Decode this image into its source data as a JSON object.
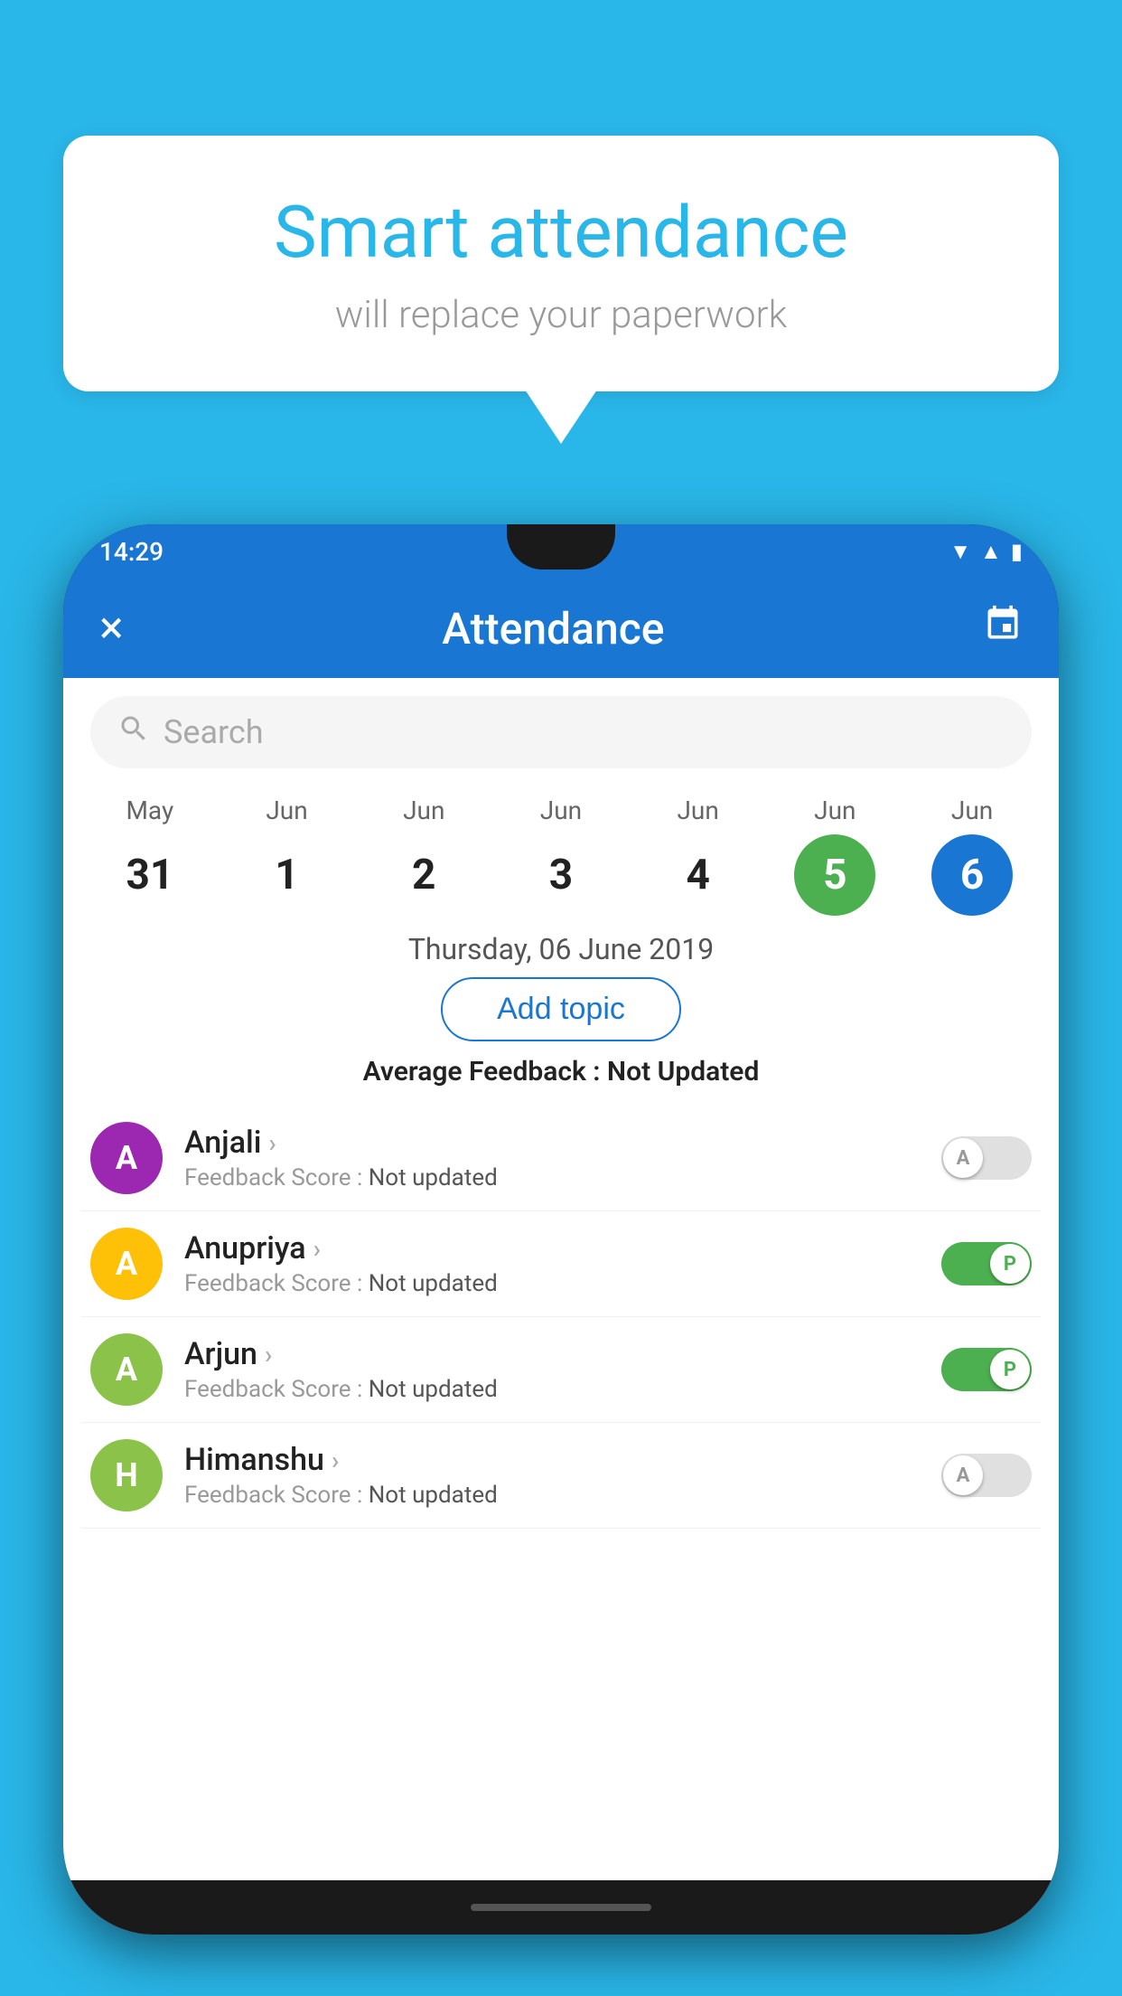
{
  "background_color": "#29b6e8",
  "speech_bubble": {
    "title": "Smart attendance",
    "subtitle": "will replace your paperwork"
  },
  "phone": {
    "status_bar": {
      "time": "14:29",
      "icons": [
        "wifi",
        "signal",
        "battery"
      ]
    },
    "app_header": {
      "title": "Attendance",
      "close_label": "×",
      "calendar_label": "📅"
    },
    "search": {
      "placeholder": "Search"
    },
    "calendar": {
      "days": [
        {
          "month": "May",
          "date": "31",
          "state": "normal"
        },
        {
          "month": "Jun",
          "date": "1",
          "state": "normal"
        },
        {
          "month": "Jun",
          "date": "2",
          "state": "normal"
        },
        {
          "month": "Jun",
          "date": "3",
          "state": "normal"
        },
        {
          "month": "Jun",
          "date": "4",
          "state": "normal"
        },
        {
          "month": "Jun",
          "date": "5",
          "state": "today"
        },
        {
          "month": "Jun",
          "date": "6",
          "state": "selected"
        }
      ]
    },
    "selected_date": "Thursday, 06 June 2019",
    "add_topic_label": "Add topic",
    "avg_feedback": {
      "label": "Average Feedback : ",
      "value": "Not Updated"
    },
    "students": [
      {
        "name": "Anjali",
        "avatar_letter": "A",
        "avatar_color": "#9c27b0",
        "feedback_label": "Feedback Score : ",
        "feedback_value": "Not updated",
        "attendance": "absent",
        "toggle_letter": "A"
      },
      {
        "name": "Anupriya",
        "avatar_letter": "A",
        "avatar_color": "#ffc107",
        "feedback_label": "Feedback Score : ",
        "feedback_value": "Not updated",
        "attendance": "present",
        "toggle_letter": "P"
      },
      {
        "name": "Arjun",
        "avatar_letter": "A",
        "avatar_color": "#8bc34a",
        "feedback_label": "Feedback Score : ",
        "feedback_value": "Not updated",
        "attendance": "present",
        "toggle_letter": "P"
      },
      {
        "name": "Himanshu",
        "avatar_letter": "H",
        "avatar_color": "#8bc34a",
        "feedback_label": "Feedback Score : ",
        "feedback_value": "Not updated",
        "attendance": "absent",
        "toggle_letter": "A"
      }
    ]
  }
}
